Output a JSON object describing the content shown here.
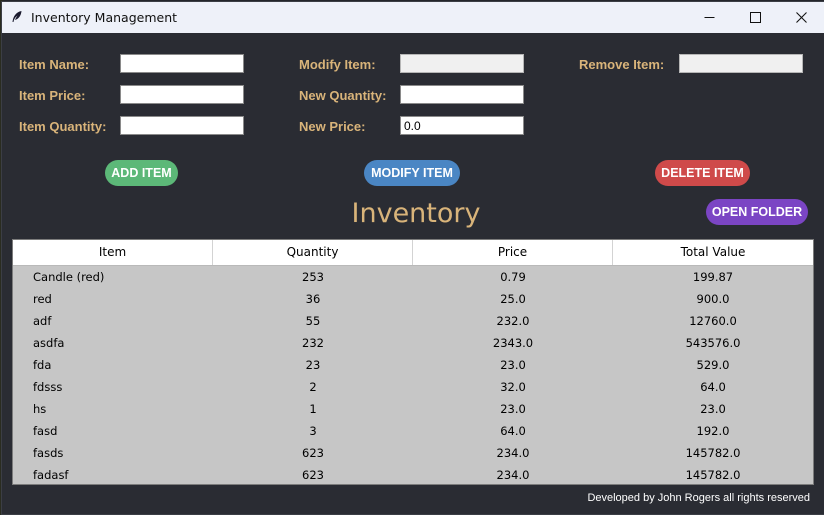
{
  "window": {
    "title": "Inventory Management",
    "icon": "feather-icon"
  },
  "form": {
    "item_name_label": "Item Name:",
    "item_price_label": "Item Price:",
    "item_quantity_label": "Item Quantity:",
    "modify_item_label": "Modify Item:",
    "new_quantity_label": "New Quantity:",
    "new_price_label": "New Price:",
    "remove_item_label": "Remove Item:",
    "item_name_value": "",
    "item_price_value": "",
    "item_quantity_value": "",
    "modify_item_value": "",
    "new_quantity_value": "",
    "new_price_value": "0.0",
    "remove_item_value": ""
  },
  "buttons": {
    "add": "ADD ITEM",
    "modify": "MODIFY ITEM",
    "delete": "DELETE ITEM",
    "open_folder": "OPEN FOLDER"
  },
  "heading": "Inventory",
  "table": {
    "columns": [
      "Item",
      "Quantity",
      "Price",
      "Total Value"
    ],
    "rows": [
      [
        "Candle (red)",
        "253",
        "0.79",
        "199.87"
      ],
      [
        "red",
        "36",
        "25.0",
        "900.0"
      ],
      [
        "adf",
        "55",
        "232.0",
        "12760.0"
      ],
      [
        "asdfa",
        "232",
        "2343.0",
        "543576.0"
      ],
      [
        "fda",
        "23",
        "23.0",
        "529.0"
      ],
      [
        "fdsss",
        "2",
        "32.0",
        "64.0"
      ],
      [
        "hs",
        "1",
        "23.0",
        "23.0"
      ],
      [
        "fasd",
        "3",
        "64.0",
        "192.0"
      ],
      [
        "fasds",
        "623",
        "234.0",
        "145782.0"
      ],
      [
        "fadasf",
        "623",
        "234.0",
        "145782.0"
      ]
    ]
  },
  "footer": "Developed by John Rogers all rights reserved",
  "colors": {
    "background": "#2a2c33",
    "label": "#d9b47a",
    "add": "#5cb878",
    "modify": "#4a86c4",
    "delete": "#cf4a4a",
    "open_folder": "#7b45c4"
  }
}
